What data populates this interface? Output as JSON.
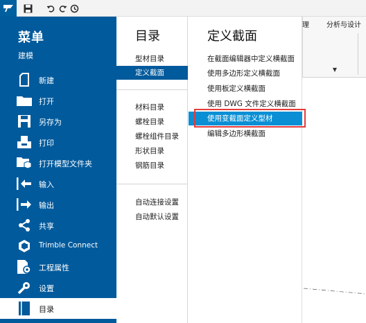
{
  "toolbar": {
    "icons": [
      "tekla-logo-icon",
      "save-icon",
      "undo-icon",
      "redo-icon",
      "history-icon"
    ]
  },
  "background": {
    "tabs": [
      "理",
      "分析与设计"
    ],
    "dropdown_arrow": "▼"
  },
  "menu": {
    "title": "菜单",
    "section": "建模",
    "items": [
      {
        "label": "新建",
        "icon": "new-file-icon"
      },
      {
        "label": "打开",
        "icon": "folder-icon"
      },
      {
        "label": "另存为",
        "icon": "save-as-icon"
      },
      {
        "label": "打印",
        "icon": "print-icon"
      },
      {
        "label": "打开模型文件夹",
        "icon": "open-model-folder-icon"
      },
      {
        "label": "输入",
        "icon": "import-icon"
      },
      {
        "label": "输出",
        "icon": "export-icon"
      },
      {
        "label": "共享",
        "icon": "share-icon"
      },
      {
        "label": "Trimble Connect",
        "icon": "trimble-connect-icon"
      },
      {
        "label": "工程属性",
        "icon": "project-properties-icon"
      },
      {
        "label": "设置",
        "icon": "settings-icon"
      },
      {
        "label": "目录",
        "icon": "catalog-icon"
      }
    ]
  },
  "catalog": {
    "title": "目录",
    "items": [
      "型材目录",
      "定义截面",
      "材料目录",
      "螺栓目录",
      "螺栓组件目录",
      "形状目录",
      "钢筋目录",
      "自动连接设置",
      "自动默认设置"
    ]
  },
  "define_section": {
    "title": "定义截面",
    "items": [
      "在截面编辑器中定义横截面",
      "使用多边形定义横截面",
      "使用板定义横截面",
      "使用 DWG 文件定义横截面",
      "使用变截面定义型材",
      "编辑多边形横截面"
    ]
  },
  "colors": {
    "menu_blue": "#005a9c",
    "highlight_blue": "#0a8fd4",
    "annotation_red": "#e53a3a"
  }
}
